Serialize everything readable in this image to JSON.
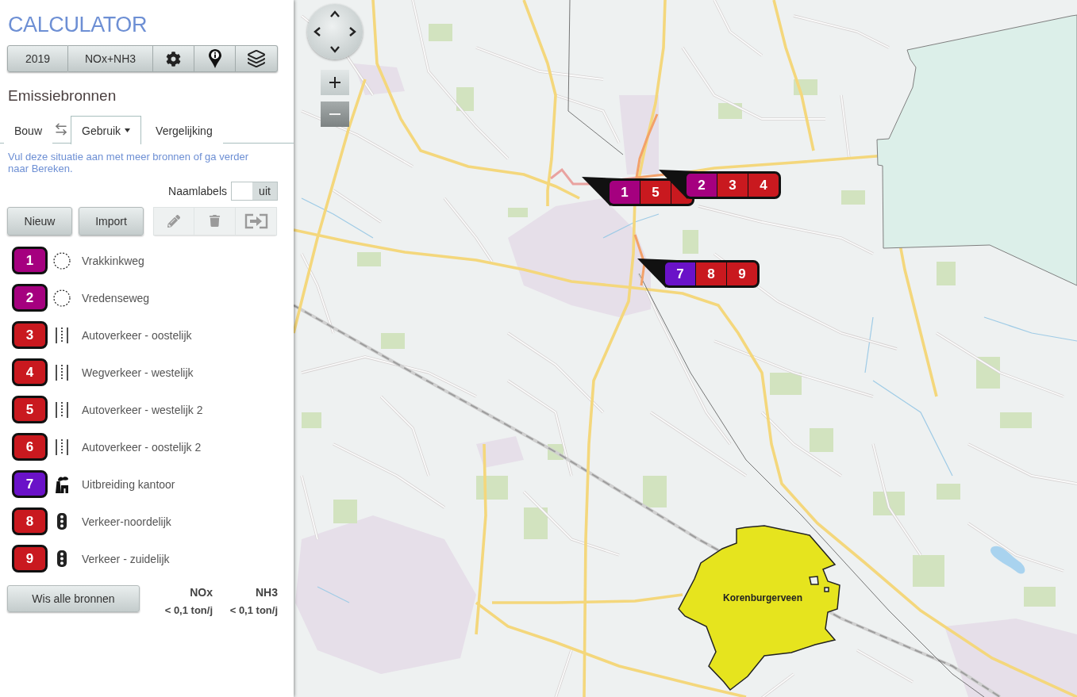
{
  "app": {
    "title": "CALCULATOR"
  },
  "toolbar": [
    {
      "kind": "text",
      "label": "2019"
    },
    {
      "kind": "text",
      "label": "NOx+NH3"
    },
    {
      "kind": "settings"
    },
    {
      "kind": "info-pin"
    },
    {
      "kind": "layers"
    }
  ],
  "section": {
    "heading": "Emissiebronnen"
  },
  "tabs": [
    {
      "label": "Bouw",
      "selected": false,
      "menu": false
    },
    {
      "label": "Gebruik",
      "selected": true,
      "menu": true
    },
    {
      "label": "Vergelijking",
      "selected": false,
      "menu": false
    }
  ],
  "hint": "Vul deze situatie aan met meer bronnen of ga verder naar Bereken.",
  "name_labels": {
    "label": "Naamlabels",
    "on": false,
    "state_text": "uit"
  },
  "buttons": [
    "Nieuw",
    "Import"
  ],
  "tools": [
    {
      "kind": "edit",
      "disabled": true
    },
    {
      "kind": "delete",
      "disabled": true
    },
    {
      "kind": "export",
      "disabled": true
    }
  ],
  "sources": [
    {
      "number": "1",
      "name": "Vrakkinkweg",
      "kind": "generic",
      "color": "#a5007f"
    },
    {
      "number": "2",
      "name": "Vredenseweg",
      "kind": "generic",
      "color": "#a5007f"
    },
    {
      "number": "3",
      "name": "Autoverkeer - oostelijk",
      "kind": "road",
      "color": "#c9191f"
    },
    {
      "number": "4",
      "name": "Wegverkeer - westelijk",
      "kind": "road",
      "color": "#c9191f"
    },
    {
      "number": "5",
      "name": "Autoverkeer - westelijk 2",
      "kind": "road",
      "color": "#c9191f"
    },
    {
      "number": "6",
      "name": "Autoverkeer - oostelijk 2",
      "kind": "road",
      "color": "#c9191f"
    },
    {
      "number": "7",
      "name": "Uitbreiding kantoor",
      "kind": "industry",
      "color": "#6a12c8"
    },
    {
      "number": "8",
      "name": "Verkeer-noordelijk",
      "kind": "traffic",
      "color": "#c9191f"
    },
    {
      "number": "9",
      "name": "Verkeer - zuidelijk",
      "kind": "traffic",
      "color": "#c9191f"
    }
  ],
  "clear_button": "Wis alle bronnen",
  "totals": [
    {
      "label": "NOx",
      "value": "< 0,1 ton/j"
    },
    {
      "label": "NH3",
      "value": "< 0,1 ton/j"
    }
  ],
  "map": {
    "markers": [
      {
        "cells": [
          {
            "label": "1",
            "color": "#a5007f"
          },
          {
            "label": "5",
            "color": "#c9191f"
          },
          {
            "color": "#c9191f"
          }
        ]
      },
      {
        "cells": [
          {
            "label": "2",
            "color": "#a5007f"
          },
          {
            "label": "3",
            "color": "#c9191f"
          },
          {
            "label": "4",
            "color": "#c9191f"
          }
        ]
      },
      {
        "cells": [
          {
            "label": "7",
            "color": "#6a12c8"
          },
          {
            "label": "8",
            "color": "#c9191f"
          },
          {
            "label": "9",
            "color": "#c9191f"
          }
        ]
      }
    ],
    "area_label": "Korenburgerveen"
  }
}
